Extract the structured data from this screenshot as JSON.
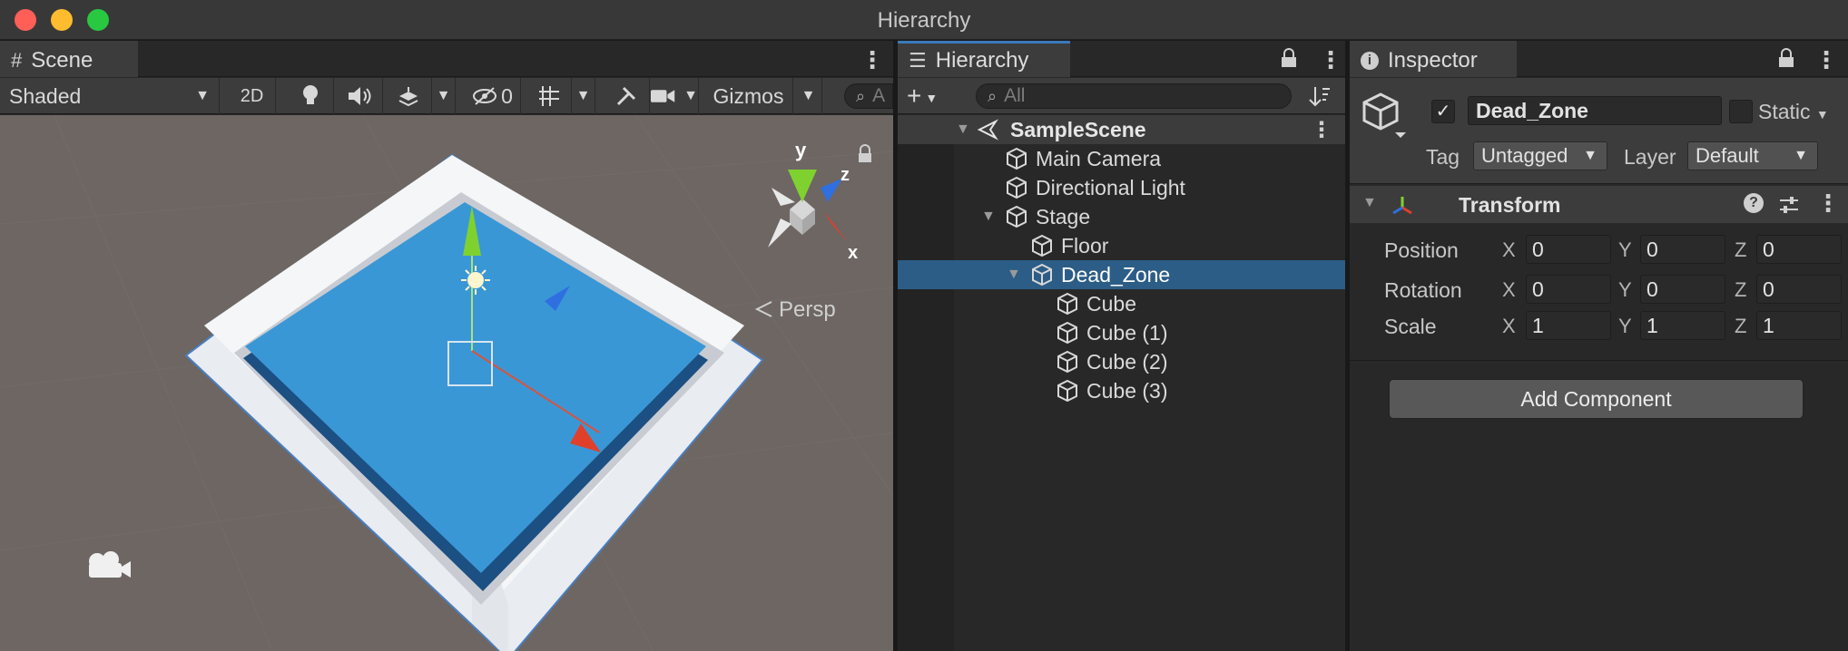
{
  "window": {
    "title": "Hierarchy"
  },
  "scene": {
    "tab_label": "Scene",
    "shading_mode": "Shaded",
    "mode_2d": "2D",
    "hidden_count": "0",
    "gizmos_label": "Gizmos",
    "search_placeholder": "A",
    "projection_label": "Persp",
    "axis_labels": {
      "x": "x",
      "y": "y",
      "z": "z"
    }
  },
  "hierarchy": {
    "tab_label": "Hierarchy",
    "search_placeholder": "All",
    "items": [
      {
        "label": "SampleScene",
        "depth": 0,
        "type": "scene",
        "expanded": true
      },
      {
        "label": "Main Camera",
        "depth": 1,
        "type": "object"
      },
      {
        "label": "Directional Light",
        "depth": 1,
        "type": "object"
      },
      {
        "label": "Stage",
        "depth": 1,
        "type": "object",
        "expanded": true
      },
      {
        "label": "Floor",
        "depth": 2,
        "type": "object"
      },
      {
        "label": "Dead_Zone",
        "depth": 2,
        "type": "object",
        "expanded": true,
        "selected": true
      },
      {
        "label": "Cube",
        "depth": 3,
        "type": "object"
      },
      {
        "label": "Cube (1)",
        "depth": 3,
        "type": "object"
      },
      {
        "label": "Cube (2)",
        "depth": 3,
        "type": "object"
      },
      {
        "label": "Cube (3)",
        "depth": 3,
        "type": "object"
      }
    ]
  },
  "inspector": {
    "tab_label": "Inspector",
    "object_name": "Dead_Zone",
    "active": true,
    "static_label": "Static",
    "tag_label": "Tag",
    "tag_value": "Untagged",
    "layer_label": "Layer",
    "layer_value": "Default",
    "component": {
      "name": "Transform",
      "rows": [
        {
          "label": "Position",
          "x": "0",
          "y": "0",
          "z": "0"
        },
        {
          "label": "Rotation",
          "x": "0",
          "y": "0",
          "z": "0"
        },
        {
          "label": "Scale",
          "x": "1",
          "y": "1",
          "z": "1"
        }
      ],
      "axis_x": "X",
      "axis_y": "Y",
      "axis_z": "Z"
    },
    "add_component_label": "Add Component"
  },
  "colors": {
    "selection": "#2c5d87",
    "water": "#3a97d6",
    "gizmo_x": "#e0402a",
    "gizmo_y": "#7fd12f",
    "gizmo_z": "#2f6fe0"
  }
}
